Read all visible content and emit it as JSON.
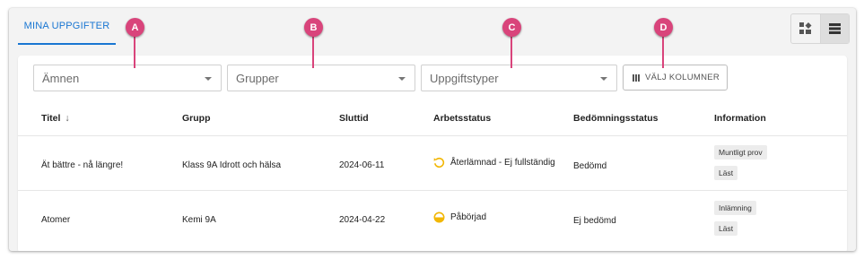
{
  "tab": {
    "label": "MINA UPPGIFTER"
  },
  "view_toggle": {
    "modes": [
      "grid-view-icon",
      "list-view-icon"
    ],
    "active": "list"
  },
  "filters": {
    "subjects_placeholder": "Ämnen",
    "groups_placeholder": "Grupper",
    "types_placeholder": "Uppgiftstyper",
    "columns_button": "VÄLJ KOLUMNER"
  },
  "columns": [
    "Titel",
    "Grupp",
    "Sluttid",
    "Arbetsstatus",
    "Bedömningsstatus",
    "Information"
  ],
  "sort_indicator": "↓",
  "rows": [
    {
      "title": "Ät bättre - nå längre!",
      "group": "Klass 9A Idrott och hälsa",
      "due": "2024-06-11",
      "work_status": "Återlämnad - Ej fullständig",
      "work_status_icon": "returned-icon",
      "grading_status": "Bedömd",
      "info": [
        "Muntligt prov",
        "Läst"
      ]
    },
    {
      "title": "Atomer",
      "group": "Kemi 9A",
      "due": "2024-04-22",
      "work_status": "Påbörjad",
      "work_status_icon": "half-circle-icon",
      "grading_status": "Ej bedömd",
      "info": [
        "Inlämning",
        "Läst"
      ]
    }
  ],
  "markers": [
    "A",
    "B",
    "C",
    "D"
  ],
  "colors": {
    "accent": "#1976d2",
    "marker": "#d9447b",
    "status_warning": "#f2b705"
  }
}
